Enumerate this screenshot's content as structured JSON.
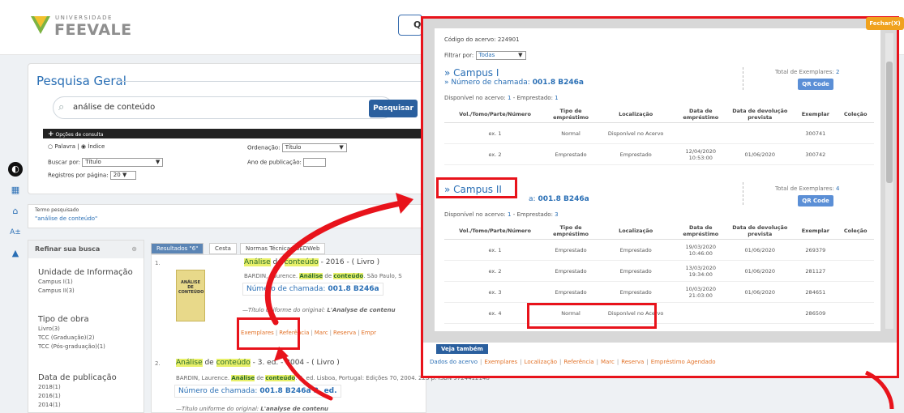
{
  "header": {
    "logo_top": "UNIVERSIDADE",
    "logo_main": "FEEVALE",
    "search_btn_glyph": "Q"
  },
  "search": {
    "title": "Pesquisa Geral",
    "query": "análise de conteúdo",
    "submit_label": "Pesquisar",
    "options_label": "Opções de consulta",
    "radio_word": "Palavra",
    "radio_index": "Índice",
    "search_by_label": "Buscar por:",
    "search_by_value": "Título",
    "order_label": "Ordenação:",
    "order_value": "Título",
    "year_label": "Ano de publicação:",
    "per_page_label": "Registros por página:",
    "per_page_value": "20"
  },
  "term": {
    "label": "Termo pesquisado",
    "value": "\"análise de conteúdo\""
  },
  "refine": {
    "title": "Refinar sua busca",
    "close_glyph": "⊗",
    "facets": [
      {
        "title": "Unidade de Informação",
        "items": [
          "Campus I(1)",
          "Campus II(3)"
        ]
      },
      {
        "title": "Tipo de obra",
        "items": [
          "Livro(3)",
          "TCC (Graduação)(2)",
          "TCC (Pós-graduação)(1)"
        ]
      },
      {
        "title": "Data de publicação",
        "items": [
          "2018(1)",
          "2016(1)",
          "2014(1)"
        ]
      }
    ]
  },
  "tabs": [
    "Resultados \"6\"",
    "Cesta",
    "Normas Técnicas GEDWeb"
  ],
  "results": [
    {
      "num": "1.",
      "title_pre": "Análise",
      "title_mid": " de ",
      "title_hl": "conteúdo",
      "title_post": " - 2016 - ( Livro )",
      "cover_text": "ANÁLISE DE CONTEÚDO",
      "author": "BARDIN, Laurence.",
      "author_hl_a": "Análise",
      "author_mid": " de ",
      "author_hl_b": "conteúdo",
      "author_rest": ". São Paulo, S",
      "call_label": "Número de chamada:",
      "call_value": "001.8 B246a",
      "uniform": "Título uniforme do original:",
      "uniform_value": "L'Analyse de contenu",
      "links": [
        "Exemplares",
        "Referência",
        "Marc",
        "Reserva",
        "Empr"
      ]
    },
    {
      "num": "2.",
      "title_pre": "Análise",
      "title_mid": " de ",
      "title_hl": "conteúdo",
      "title_post": " - 3. ed. - 2004 - ( Livro )",
      "author": "BARDIN, Laurence.",
      "author_hl_a": "Análise",
      "author_mid": " de ",
      "author_hl_b": "conteúdo",
      "author_rest": ". 3. ed. Lisboa, Portugal: Edições 70, 2004. 223 p. ISBN 9724412148",
      "call_label": "Número de chamada:",
      "call_value": "001.8 B246a 3. ed.",
      "uniform": "Título uniforme do original:",
      "uniform_value": "L'analyse de contenu"
    }
  ],
  "modal": {
    "close_label": "Fechar(X)",
    "acervo_code_label": "Código do acervo:",
    "acervo_code": "224901",
    "filter_label": "Filtrar por:",
    "filter_value": "Todas",
    "columns": [
      "Vol./Tomo/Parte/Número",
      "Tipo de empréstimo",
      "Localização",
      "Data de empréstimo",
      "Data de devolução prevista",
      "Exemplar",
      "Coleção"
    ],
    "campuses": [
      {
        "name": "» Campus I",
        "call_label": "» Número de chamada:",
        "call_value": "001.8 B246a",
        "total_label": "Total de Exemplares:",
        "total_value": "2",
        "qr_label": "QR Code",
        "avail_label": "Disponível no acervo:",
        "avail_value": "1",
        "loaned_label": "- Emprestado:",
        "loaned_value": "1",
        "rows": [
          [
            "ex. 1",
            "Normal",
            "Disponível no Acervo",
            "",
            "",
            "300741",
            ""
          ],
          [
            "ex. 2",
            "Emprestado",
            "Emprestado",
            "12/04/2020 10:53:00",
            "01/06/2020",
            "300742",
            ""
          ]
        ]
      },
      {
        "name": "» Campus II",
        "call_label": "a:",
        "call_value": "001.8 B246a",
        "total_label": "Total de Exemplares:",
        "total_value": "4",
        "qr_label": "QR Code",
        "avail_label": "Disponível no acervo:",
        "avail_value": "1",
        "loaned_label": "- Emprestado:",
        "loaned_value": "3",
        "rows": [
          [
            "ex. 1",
            "Emprestado",
            "Emprestado",
            "19/03/2020 10:46:00",
            "01/06/2020",
            "269379",
            ""
          ],
          [
            "ex. 2",
            "Emprestado",
            "Emprestado",
            "13/03/2020 19:34:00",
            "01/06/2020",
            "281127",
            ""
          ],
          [
            "ex. 3",
            "Emprestado",
            "Emprestado",
            "10/03/2020 21:03:00",
            "01/06/2020",
            "284651",
            ""
          ],
          [
            "ex. 4",
            "Normal",
            "Disponível no Acervo",
            "",
            "",
            "286509",
            ""
          ]
        ]
      }
    ],
    "veja_label": "Veja também",
    "veja_links": [
      "Dados do acervo",
      "Exemplares",
      "Localização",
      "Referência",
      "Marc",
      "Reserva",
      "Empréstimo Agendado"
    ]
  },
  "colors": {
    "accent": "#2a6fb5",
    "highlight_red": "#e8131b",
    "orange": "#e2732a",
    "fechar": "#f0a21e"
  }
}
